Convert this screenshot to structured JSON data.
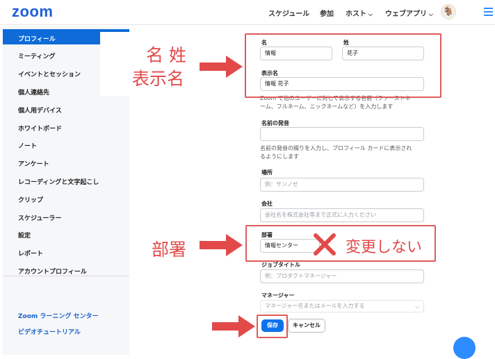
{
  "app": {
    "logo": "zoom"
  },
  "topnav": {
    "schedule": "スケジュール",
    "join": "参加",
    "host": "ホスト",
    "webapp": "ウェブアプリ",
    "avatar_glyph": "🐐"
  },
  "sidebar": {
    "items": [
      "プロフィール",
      "ミーティング",
      "イベントとセッション",
      "個人連絡先",
      "個人用デバイス",
      "ホワイトボード",
      "ノート",
      "アンケート",
      "レコーディングと文字起こし",
      "クリップ",
      "スケジューラー",
      "設定",
      "レポート",
      "アカウントプロフィール"
    ],
    "links": [
      "Zoom ラーニング センター",
      "ビデオチュートリアル"
    ]
  },
  "annotations": {
    "name_label": "名 姓",
    "display_label": "表示名",
    "dept_label": "部署",
    "no_change": "変更しない",
    "color": "#e24a4a"
  },
  "form": {
    "first_name": {
      "label": "名",
      "value": "情報"
    },
    "last_name": {
      "label": "姓",
      "value": "花子"
    },
    "display_name": {
      "label": "表示名",
      "value": "情報 花子"
    },
    "display_help_1": "Zoom で他のユーザーに対して表示する名前（ファーストネ",
    "display_help_2": "ーム、フルネーム、ニックネームなど）を入力します",
    "pronunciation": {
      "label": "名前の発音",
      "value": ""
    },
    "pronunciation_help_1": "名前の発音の綴りを入力し、プロフィール カードに表示され",
    "pronunciation_help_2": "るようにします",
    "location": {
      "label": "場所",
      "placeholder": "例：サンノゼ"
    },
    "company": {
      "label": "会社",
      "placeholder": "会社名を株式会社等まで正式に入力ください"
    },
    "department": {
      "label": "部署",
      "value": "情報センター"
    },
    "job_title": {
      "label": "ジョブタイトル",
      "placeholder": "例：プロダクトマネージャー"
    },
    "manager": {
      "label": "マネージャー",
      "placeholder": "マネージャー名またはメールを入力する"
    },
    "save": "保存",
    "cancel": "キャンセル"
  }
}
